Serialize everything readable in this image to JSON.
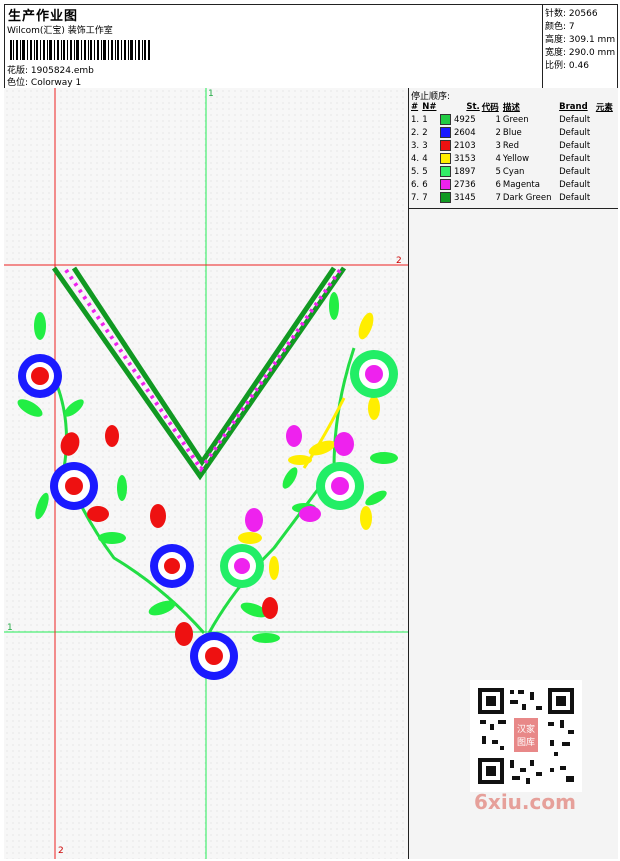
{
  "header": {
    "title": "生产作业图",
    "company": "Wilcom(汇宝) 装饰工作室",
    "design_label": "花版:",
    "design_value": "1905824.emb",
    "colorway_label": "色位:",
    "colorway_value": "Colorway 1"
  },
  "stats": [
    {
      "label": "针数:",
      "value": "20566"
    },
    {
      "label": "颜色:",
      "value": "7"
    },
    {
      "label": "高度:",
      "value": "309.1 mm"
    },
    {
      "label": "宽度:",
      "value": "290.0 mm"
    },
    {
      "label": "比例:",
      "value": "0.46"
    }
  ],
  "stop_sequence": {
    "heading": "停止顺序:",
    "columns": [
      "#",
      "N#",
      "St.",
      "代码",
      "描述",
      "Brand",
      "元素"
    ],
    "rows": [
      {
        "idx": "1.",
        "n": "1",
        "color": "#22cc44",
        "st": "4925",
        "code": "1",
        "desc": "Green",
        "brand": "Default"
      },
      {
        "idx": "2.",
        "n": "2",
        "color": "#1a1aff",
        "st": "2604",
        "code": "2",
        "desc": "Blue",
        "brand": "Default"
      },
      {
        "idx": "3.",
        "n": "3",
        "color": "#ee1111",
        "st": "2103",
        "code": "3",
        "desc": "Red",
        "brand": "Default"
      },
      {
        "idx": "4.",
        "n": "4",
        "color": "#ffee00",
        "st": "3153",
        "code": "4",
        "desc": "Yellow",
        "brand": "Default"
      },
      {
        "idx": "5.",
        "n": "5",
        "color": "#33ee66",
        "st": "1897",
        "code": "5",
        "desc": "Cyan",
        "brand": "Default"
      },
      {
        "idx": "6.",
        "n": "6",
        "color": "#ee22ee",
        "st": "2736",
        "code": "6",
        "desc": "Magenta",
        "brand": "Default"
      },
      {
        "idx": "7.",
        "n": "7",
        "color": "#119922",
        "st": "3145",
        "code": "7",
        "desc": "Dark Green",
        "brand": "Default"
      }
    ]
  },
  "axis_labels": {
    "top_green": "1",
    "right_red": "2",
    "left_green": "1",
    "bottom_red": "2"
  },
  "watermark": "6xiu.com",
  "qr_stamp": "汉家图库",
  "colors": {
    "green": "#22cc44",
    "blue": "#1a1aff",
    "red": "#ee1111",
    "yellow": "#ffee00",
    "cyan": "#33ee66",
    "magenta": "#ee22ee",
    "dark_green": "#119922"
  }
}
